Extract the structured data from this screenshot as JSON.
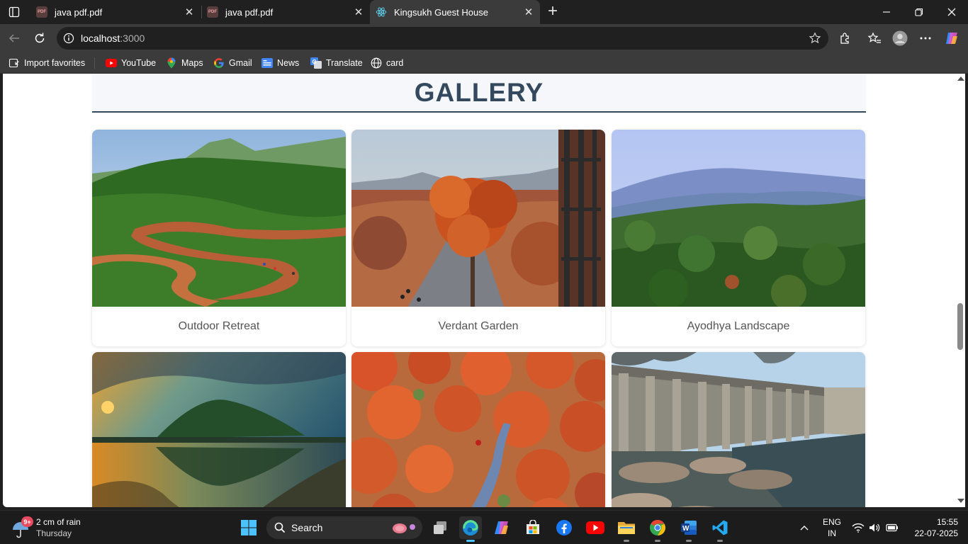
{
  "browser": {
    "tabs": [
      {
        "title": "java pdf.pdf",
        "icon": "pdf-icon",
        "active": false
      },
      {
        "title": "java pdf.pdf",
        "icon": "pdf-icon",
        "active": false
      },
      {
        "title": "Kingsukh Guest House",
        "icon": "react-icon",
        "active": true
      }
    ],
    "pdf_badge": "PDF",
    "address": {
      "host": "localhost",
      "port": ":3000"
    },
    "favorites": [
      {
        "label": "Import favorites",
        "icon": "import-icon"
      },
      {
        "label": "YouTube",
        "icon": "youtube-icon"
      },
      {
        "label": "Maps",
        "icon": "maps-icon"
      },
      {
        "label": "Gmail",
        "icon": "google-icon"
      },
      {
        "label": "News",
        "icon": "news-icon"
      },
      {
        "label": "Translate",
        "icon": "translate-icon"
      },
      {
        "label": "card",
        "icon": "globe-icon"
      }
    ],
    "accent": "#34495e"
  },
  "page": {
    "heading": "GALLERY",
    "gallery": [
      {
        "caption": "Outdoor Retreat",
        "scene": "green-hills-winding-road"
      },
      {
        "caption": "Verdant Garden",
        "scene": "palash-tree-road"
      },
      {
        "caption": "Ayodhya Landscape",
        "scene": "blue-hills-forest"
      },
      {
        "caption": "",
        "scene": "sunset-hill-lake"
      },
      {
        "caption": "",
        "scene": "red-forest-path"
      },
      {
        "caption": "",
        "scene": "dam-reservoir"
      }
    ]
  },
  "taskbar": {
    "weather": {
      "notification_count": "9+",
      "line1": "2 cm of rain",
      "line2": "Thursday"
    },
    "search_label": "Search",
    "language": {
      "line1": "ENG",
      "line2": "IN"
    },
    "clock": {
      "time": "15:55",
      "date": "22-07-2025"
    }
  }
}
